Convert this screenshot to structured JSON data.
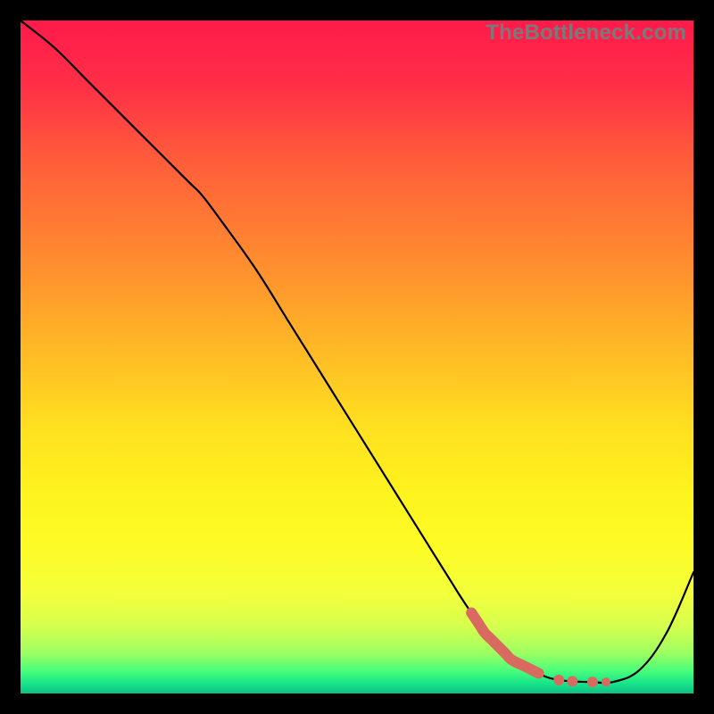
{
  "watermark": "TheBottleneck.com",
  "gradient": {
    "stops": [
      {
        "offset": 0.0,
        "color": "#ff1a4b"
      },
      {
        "offset": 0.1,
        "color": "#ff3046"
      },
      {
        "offset": 0.2,
        "color": "#ff5a3b"
      },
      {
        "offset": 0.3,
        "color": "#ff7a33"
      },
      {
        "offset": 0.4,
        "color": "#ff9a2c"
      },
      {
        "offset": 0.5,
        "color": "#ffbd25"
      },
      {
        "offset": 0.6,
        "color": "#ffdf20"
      },
      {
        "offset": 0.7,
        "color": "#fef31e"
      },
      {
        "offset": 0.78,
        "color": "#fdfb26"
      },
      {
        "offset": 0.85,
        "color": "#f4ff3a"
      },
      {
        "offset": 0.9,
        "color": "#d6ff4e"
      },
      {
        "offset": 0.94,
        "color": "#9dff62"
      },
      {
        "offset": 0.965,
        "color": "#4dff7a"
      },
      {
        "offset": 0.985,
        "color": "#17e589"
      },
      {
        "offset": 1.0,
        "color": "#0fbf87"
      }
    ]
  },
  "chart_data": {
    "type": "line",
    "title": "",
    "xlabel": "",
    "ylabel": "",
    "xlim": [
      0,
      100
    ],
    "ylim": [
      0,
      100
    ],
    "series": [
      {
        "name": "bottleneck-curve",
        "x": [
          0,
          5,
          10,
          15,
          20,
          25,
          27,
          30,
          35,
          40,
          45,
          50,
          55,
          60,
          65,
          67,
          70,
          72,
          75,
          78,
          80,
          82,
          85,
          88,
          92,
          96,
          100
        ],
        "y": [
          100,
          96,
          91,
          86,
          81,
          76,
          74,
          70,
          63,
          55,
          47,
          39,
          31,
          23,
          15,
          12,
          8,
          6,
          4,
          2.5,
          2,
          1.8,
          1.7,
          1.7,
          3.5,
          9,
          18
        ]
      },
      {
        "name": "highlight-segment",
        "x": [
          67,
          68,
          69,
          70,
          71,
          72,
          73,
          75,
          77,
          80,
          82,
          85,
          87
        ],
        "y": [
          12,
          10.5,
          9,
          8,
          7,
          6,
          5,
          4,
          3,
          2,
          1.8,
          1.7,
          1.7
        ]
      }
    ],
    "highlight_color": "#d86a5f"
  }
}
